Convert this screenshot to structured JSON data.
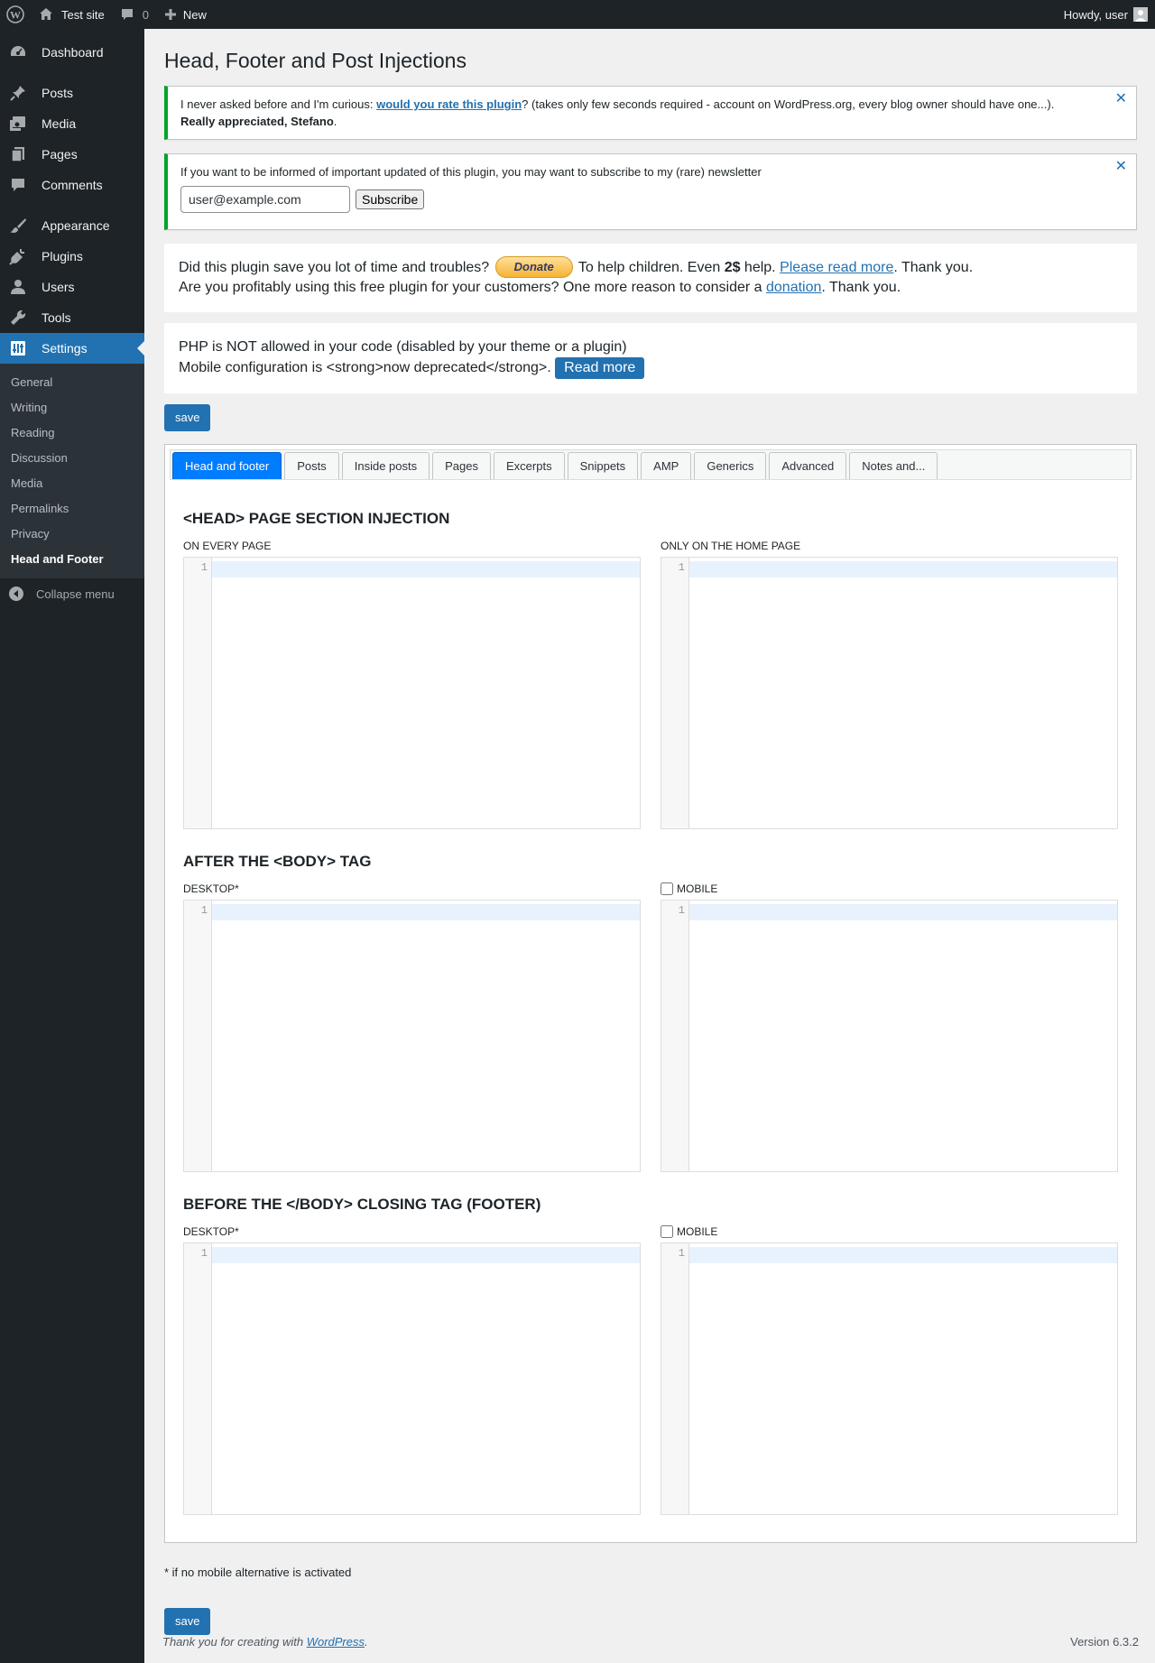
{
  "adminbar": {
    "site_name": "Test site",
    "comments_count": "0",
    "new_label": "New",
    "greeting": "Howdy, user"
  },
  "sidebar": {
    "items": [
      {
        "label": "Dashboard",
        "icon": "dashboard-icon"
      },
      {
        "label": "Posts",
        "icon": "pushpin-icon"
      },
      {
        "label": "Media",
        "icon": "media-icon"
      },
      {
        "label": "Pages",
        "icon": "pages-icon"
      },
      {
        "label": "Comments",
        "icon": "comment-icon"
      },
      {
        "label": "Appearance",
        "icon": "brush-icon"
      },
      {
        "label": "Plugins",
        "icon": "plug-icon"
      },
      {
        "label": "Users",
        "icon": "user-icon"
      },
      {
        "label": "Tools",
        "icon": "wrench-icon"
      },
      {
        "label": "Settings",
        "icon": "settings-icon"
      }
    ],
    "submenu": [
      "General",
      "Writing",
      "Reading",
      "Discussion",
      "Media",
      "Permalinks",
      "Privacy",
      "Head and Footer"
    ],
    "collapse_label": "Collapse menu"
  },
  "page": {
    "title": "Head, Footer and Post Injections"
  },
  "notice_rate": {
    "before": "I never asked before and I'm curious: ",
    "link": "would you rate this plugin",
    "after": "? (takes only few seconds required - account on WordPress.org, every blog owner should have one...). ",
    "strong": "Really appreciated, Stefano",
    "end": "."
  },
  "notice_newsletter": {
    "text": "If you want to be informed of important updated of this plugin, you may want to subscribe to my (rare) newsletter",
    "email_value": "user@example.com",
    "subscribe_label": "Subscribe"
  },
  "donate_box": {
    "line1_before": "Did this plugin save you lot of time and troubles?",
    "donate_label": "Donate",
    "line1_mid": "To help children. Even ",
    "line1_strong": "2$",
    "line1_mid2": " help. ",
    "line1_link": "Please read more",
    "line1_end": ". Thank you.",
    "line2_before": "Are you profitably using this free plugin for your customers? One more reason to consider a ",
    "line2_link": "donation",
    "line2_end": ". Thank you."
  },
  "php_box": {
    "line1": "PHP is NOT allowed in your code (disabled by your theme or a plugin)",
    "line2": "Mobile configuration is <strong>now deprecated</strong>.",
    "read_more": "Read more"
  },
  "save_label": "save",
  "tabs": [
    "Head and footer",
    "Posts",
    "Inside posts",
    "Pages",
    "Excerpts",
    "Snippets",
    "AMP",
    "Generics",
    "Advanced",
    "Notes and..."
  ],
  "sections": {
    "head": {
      "title": "<HEAD> PAGE SECTION INJECTION",
      "left": "ON EVERY PAGE",
      "right": "ONLY ON THE HOME PAGE"
    },
    "body": {
      "title": "AFTER THE <BODY> TAG",
      "left": "DESKTOP*",
      "right": "MOBILE"
    },
    "footer": {
      "title": "BEFORE THE </BODY> CLOSING TAG (FOOTER)",
      "left": "DESKTOP*",
      "right": "MOBILE"
    }
  },
  "line_number": "1",
  "footnote": "* if no mobile alternative is activated",
  "footer": {
    "thanks_before": "Thank you for creating with ",
    "thanks_link": "WordPress",
    "thanks_end": ".",
    "version": "Version 6.3.2"
  }
}
